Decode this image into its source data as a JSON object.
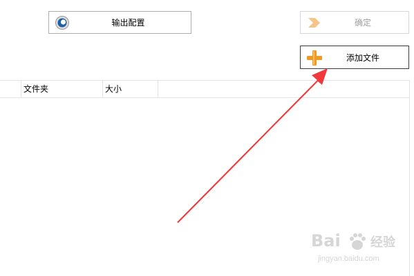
{
  "toolbar": {
    "output_config_label": "输出配置",
    "ok_label": "确定",
    "add_file_label": "添加文件"
  },
  "table": {
    "headers": [
      "",
      "文件夹",
      "大小"
    ]
  },
  "watermark": {
    "logo_text": "Bai",
    "logo_suffix": "经验",
    "url": "jingyan.baidu.com"
  },
  "colors": {
    "arrow": "#f0393c",
    "ok_icon": "#f7b86f",
    "add_icon": "#f39a1e"
  }
}
